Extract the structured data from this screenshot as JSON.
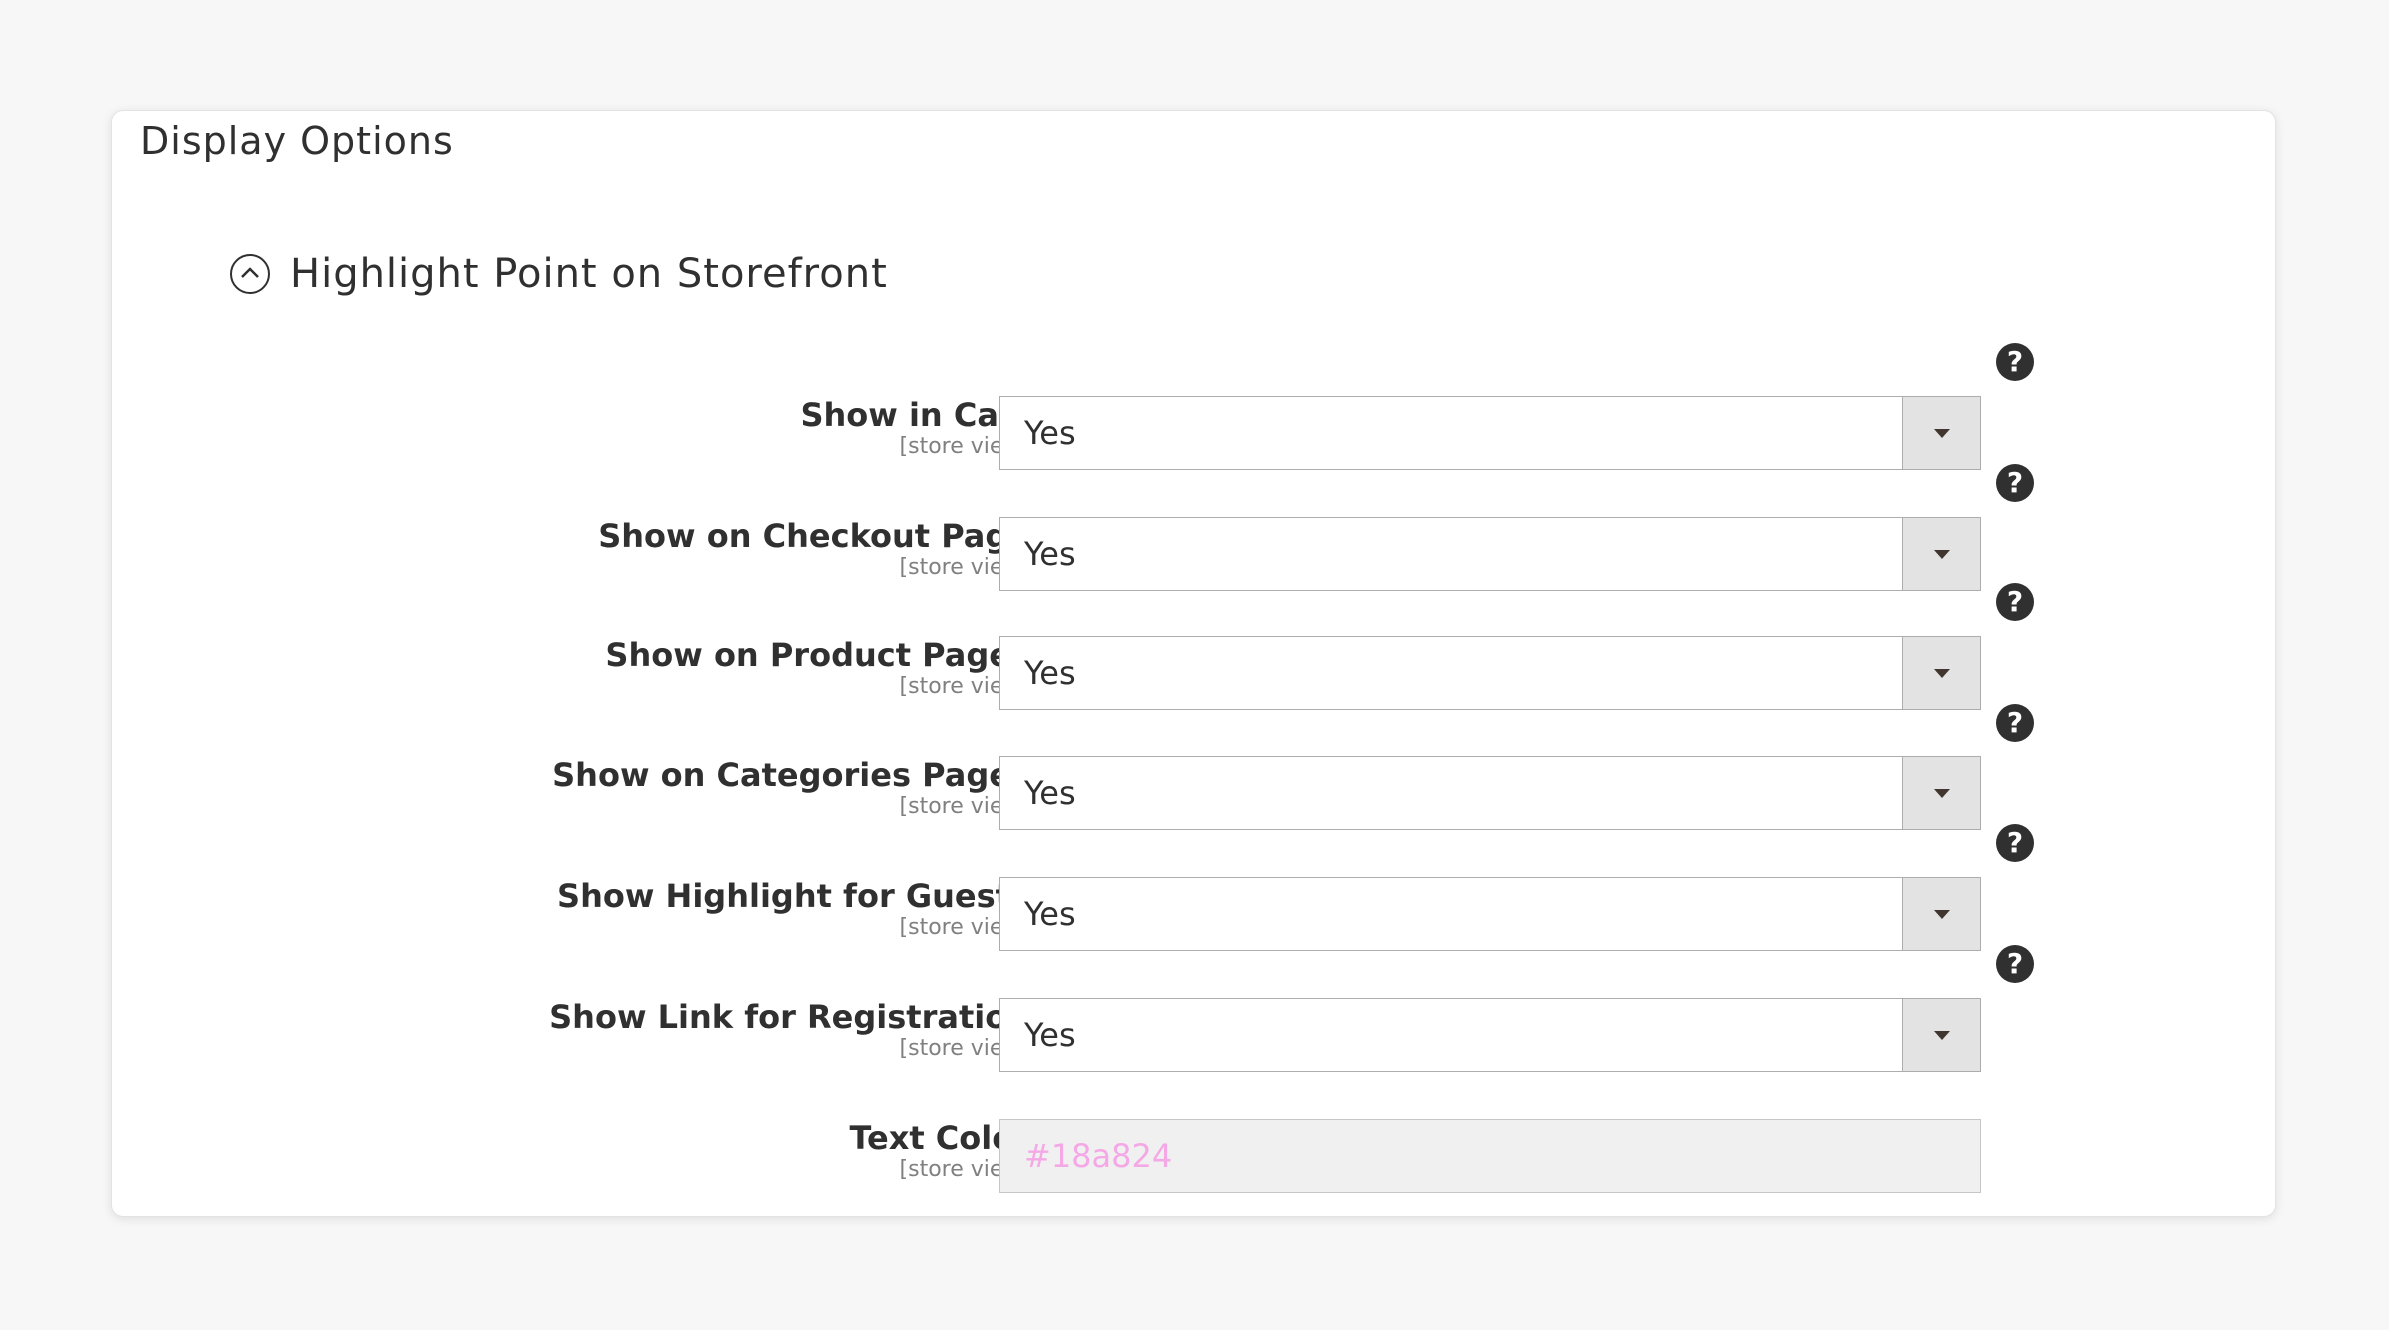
{
  "panel": {
    "title": "Display Options",
    "section": {
      "title": "Highlight Point on Storefront"
    }
  },
  "fields": [
    {
      "label": "Show in Cart",
      "scope": "[store view]",
      "value": "Yes"
    },
    {
      "label": "Show on Checkout Page",
      "scope": "[store view]",
      "value": "Yes"
    },
    {
      "label": "Show on Product Pages",
      "scope": "[store view]",
      "value": "Yes"
    },
    {
      "label": "Show on Categories Pages",
      "scope": "[store view]",
      "value": "Yes"
    },
    {
      "label": "Show Highlight for Guests",
      "scope": "[store view]",
      "value": "Yes"
    },
    {
      "label": "Show Link for Registration",
      "scope": "[store view]",
      "value": "Yes"
    }
  ],
  "text_color": {
    "label": "Text Color",
    "scope": "[store view]",
    "value": "#18a824"
  },
  "help_icon_glyph": "?",
  "colors": {
    "background": "#f7f7f7",
    "panel": "#ffffff",
    "text": "#303030",
    "scope_text": "#808080",
    "select_button": "#e3e3e3",
    "text_color_value": "#f5a8e6"
  }
}
